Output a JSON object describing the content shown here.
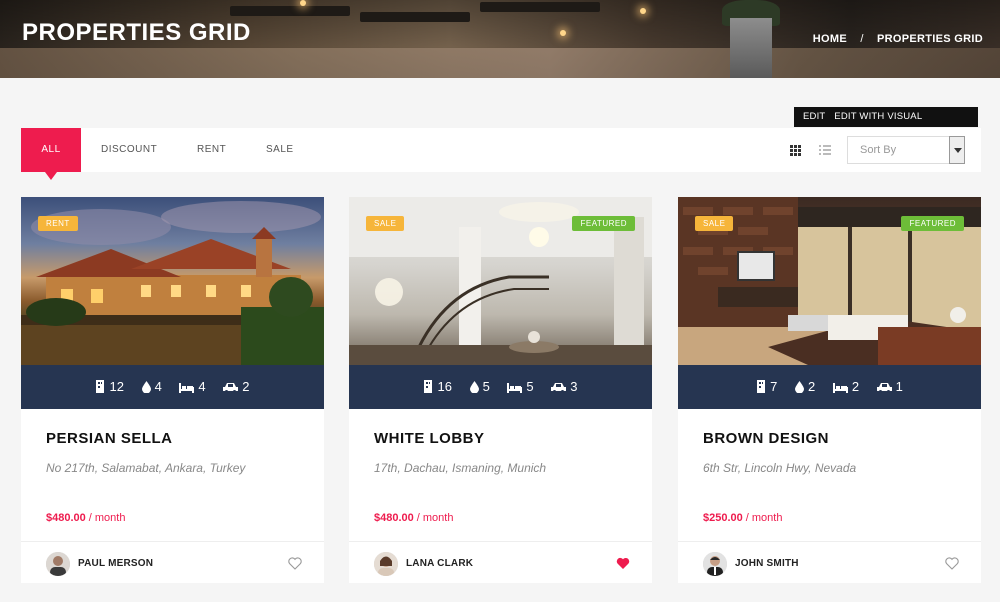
{
  "header": {
    "title": "PROPERTIES GRID",
    "breadcrumb": [
      "HOME",
      "/",
      "PROPERTIES GRID"
    ]
  },
  "editbar": {
    "edit": "EDIT",
    "composer": "EDIT WITH VISUAL COMPOSER"
  },
  "filters": {
    "tabs": [
      "ALL",
      "DISCOUNT",
      "RENT",
      "SALE"
    ],
    "active": "ALL",
    "sort_placeholder": "Sort By"
  },
  "colors": {
    "accent": "#ee1c4e",
    "stats_bar": "#263551",
    "rent_badge": "#f6b53a",
    "featured_badge": "#6dbd38"
  },
  "properties": [
    {
      "type_badge": "RENT",
      "featured": "",
      "stats": {
        "rooms": "12",
        "baths": "4",
        "beds": "4",
        "garages": "2"
      },
      "title": "PERSIAN SELLA",
      "address": "No 217th, Salamabat, Ankara, Turkey",
      "price": "$480.00",
      "period": "/ month",
      "agent": "PAUL MERSON",
      "favorited": false
    },
    {
      "type_badge": "SALE",
      "featured": "FEATURED",
      "stats": {
        "rooms": "16",
        "baths": "5",
        "beds": "5",
        "garages": "3"
      },
      "title": "WHITE LOBBY",
      "address": "17th, Dachau, Ismaning, Munich",
      "price": "$480.00",
      "period": "/ month",
      "agent": "LANA CLARK",
      "favorited": true
    },
    {
      "type_badge": "SALE",
      "featured": "FEATURED",
      "stats": {
        "rooms": "7",
        "baths": "2",
        "beds": "2",
        "garages": "1"
      },
      "title": "BROWN DESIGN",
      "address": "6th Str, Lincoln Hwy, Nevada",
      "price": "$250.00",
      "period": "/ month",
      "agent": "JOHN SMITH",
      "favorited": false
    }
  ]
}
